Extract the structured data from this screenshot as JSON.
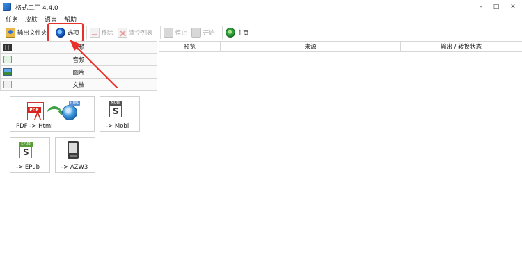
{
  "window": {
    "title": "格式工厂 4.4.0",
    "controls": {
      "minimize": "–",
      "maximize": "□",
      "close": "✕"
    }
  },
  "menu": {
    "items": [
      "任务",
      "皮肤",
      "语言",
      "帮助"
    ]
  },
  "toolbar": {
    "output_folder": {
      "label": "输出文件夹",
      "icon": "folder-icon",
      "enabled": true
    },
    "options": {
      "label": "选项",
      "icon": "options-disc-icon",
      "enabled": true,
      "highlighted": true
    },
    "remove": {
      "label": "移除",
      "icon": "remove-icon",
      "enabled": false
    },
    "clear_list": {
      "label": "清空列表",
      "icon": "clear-list-icon",
      "enabled": false
    },
    "stop": {
      "label": "停止",
      "icon": "stop-icon",
      "enabled": false
    },
    "start": {
      "label": "开始",
      "icon": "start-icon",
      "enabled": false
    },
    "home": {
      "label": "主页",
      "icon": "home-globe-icon",
      "enabled": true
    }
  },
  "categories": [
    {
      "label": "视频",
      "icon": "video-icon"
    },
    {
      "label": "音频",
      "icon": "audio-icon"
    },
    {
      "label": "图片",
      "icon": "image-icon"
    },
    {
      "label": "文档",
      "icon": "document-icon"
    }
  ],
  "document_tools": [
    {
      "label": "PDF -> Html",
      "icon": "pdf-to-html-icon"
    },
    {
      "label": "-> Mobi",
      "icon": "mobi-icon",
      "icon_text": "MOBI"
    },
    {
      "label": "-> EPub",
      "icon": "epub-icon",
      "icon_text": "EPUB"
    },
    {
      "label": "-> AZW3",
      "icon": "kindle-icon"
    }
  ],
  "task_table": {
    "columns": [
      "预览",
      "来源",
      "输出 / 转换状态"
    ],
    "rows": []
  },
  "colors": {
    "highlight": "#e8312a",
    "annotation_arrow": "#e8312a"
  }
}
